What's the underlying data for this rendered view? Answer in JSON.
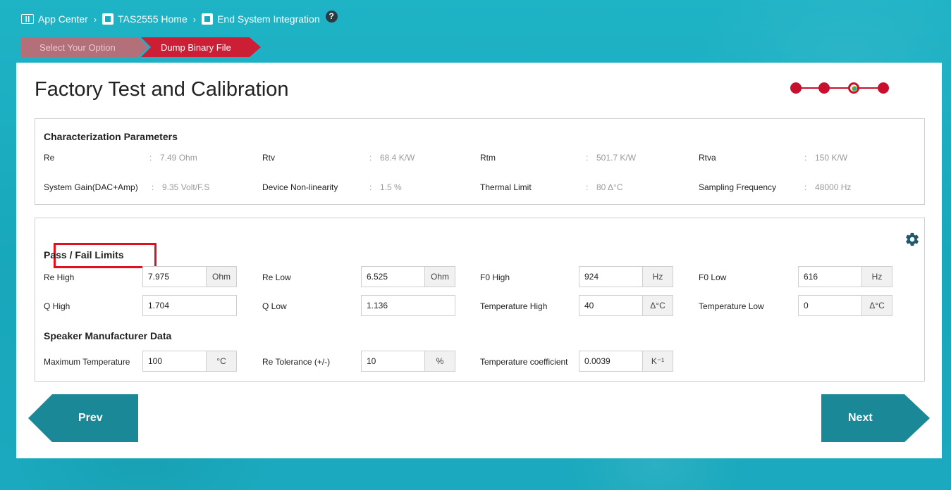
{
  "breadcrumb": {
    "items": [
      {
        "label": "App Center",
        "icon": "app-grid-icon"
      },
      {
        "label": "TAS2555 Home",
        "icon": "chip-icon"
      },
      {
        "label": "End System Integration",
        "icon": "chip-icon"
      }
    ],
    "separator": "›",
    "help": "?"
  },
  "wizard": {
    "steps": [
      {
        "label": "Select Your Option",
        "state": "done"
      },
      {
        "label": "Dump Binary File",
        "state": "active"
      }
    ]
  },
  "page": {
    "title": "Factory Test and Calibration",
    "progress": {
      "total": 4,
      "current": 3
    }
  },
  "characterization": {
    "title": "Characterization Parameters",
    "colon": ":",
    "params": [
      {
        "label": "Re",
        "value": "7.49 Ohm"
      },
      {
        "label": "Rtv",
        "value": "68.4 K/W"
      },
      {
        "label": "Rtm",
        "value": "501.7 K/W"
      },
      {
        "label": "Rtva",
        "value": "150 K/W"
      },
      {
        "label": "System Gain(DAC+Amp)",
        "value": "9.35 Volt/F.S"
      },
      {
        "label": "Device Non-linearity",
        "value": "1.5 %"
      },
      {
        "label": "Thermal Limit",
        "value": "80 Δ°C"
      },
      {
        "label": "Sampling Frequency",
        "value": "48000 Hz"
      }
    ]
  },
  "limits": {
    "title": "Pass / Fail Limits",
    "fields": [
      {
        "label": "Re High",
        "value": "7.975",
        "unit": "Ohm"
      },
      {
        "label": "Re Low",
        "value": "6.525",
        "unit": "Ohm"
      },
      {
        "label": "F0 High",
        "value": "924",
        "unit": "Hz"
      },
      {
        "label": "F0 Low",
        "value": "616",
        "unit": "Hz"
      },
      {
        "label": "Q High",
        "value": "1.704",
        "unit": ""
      },
      {
        "label": "Q Low",
        "value": "1.136",
        "unit": ""
      },
      {
        "label": "Temperature High",
        "value": "40",
        "unit": "Δ°C"
      },
      {
        "label": "Temperature Low",
        "value": "0",
        "unit": "Δ°C"
      }
    ]
  },
  "speaker": {
    "title": "Speaker Manufacturer Data",
    "fields": [
      {
        "label": "Maximum Temperature",
        "value": "100",
        "unit": "°C"
      },
      {
        "label": "Re Tolerance (+/-)",
        "value": "10",
        "unit": "%"
      },
      {
        "label": "Temperature coefficient",
        "value": "0.0039",
        "unit": "K⁻¹"
      }
    ]
  },
  "nav": {
    "prev": "Prev",
    "next": "Next"
  },
  "colors": {
    "accent": "#1aa9be",
    "brand_red": "#c8102e",
    "button": "#1a8896"
  }
}
